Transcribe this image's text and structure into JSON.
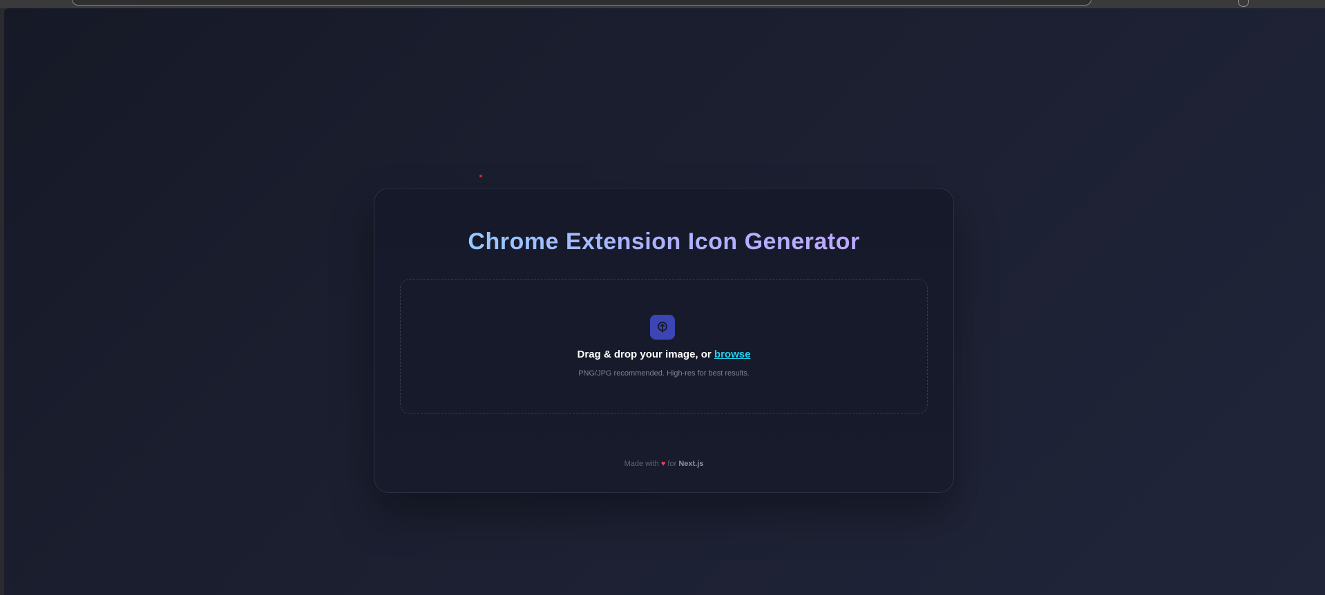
{
  "page": {
    "title": "Chrome Extension Icon Generator"
  },
  "dropzone": {
    "icon": "upload-icon",
    "prompt": "Drag & drop your image, or",
    "browse_label": "browse",
    "hint": "PNG/JPG recommended. High-res for best results."
  },
  "footer": {
    "made_with": "Made with",
    "heart": "♥",
    "for_text": "for",
    "brand": "Next.js"
  },
  "colors": {
    "accent": "#22d3ee",
    "icon_bg": "#3b45b5",
    "heart": "#f43f5e",
    "title_gradient_start": "#8fd3ff",
    "title_gradient_end": "#c7a4ff"
  }
}
